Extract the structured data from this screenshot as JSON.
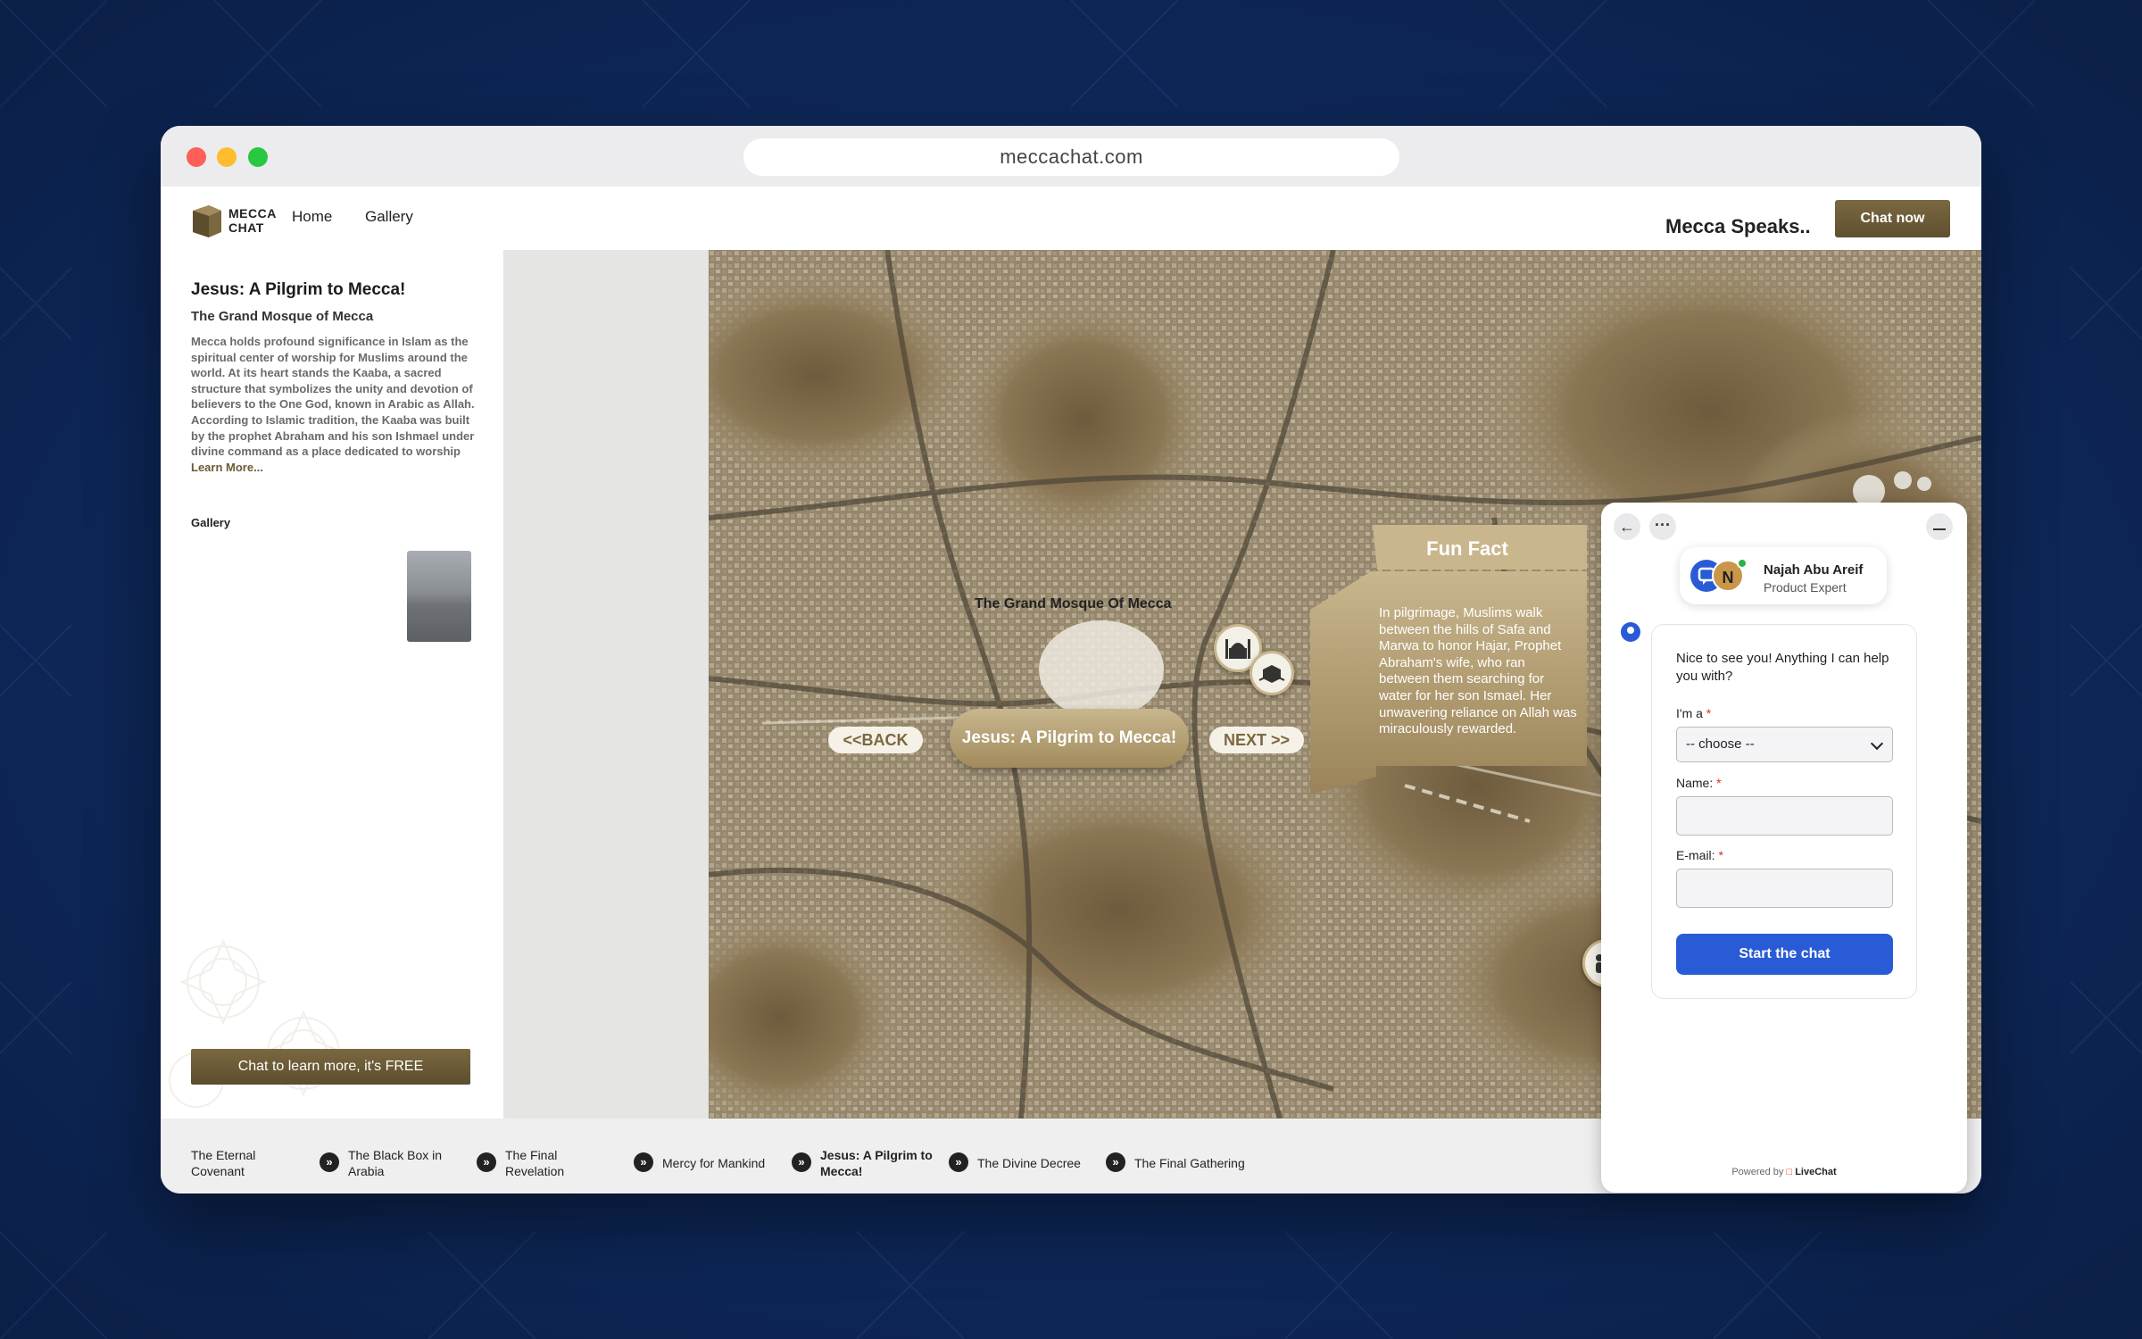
{
  "browser": {
    "url": "meccachat.com"
  },
  "nav": {
    "logo_line1": "MECCA",
    "logo_line2": "CHAT",
    "home": "Home",
    "gallery": "Gallery",
    "tagline": "Mecca Speaks..",
    "chat_now": "Chat now"
  },
  "sidebar": {
    "title": "Jesus: A Pilgrim to Mecca!",
    "subtitle": "The Grand Mosque of Mecca",
    "body": "Mecca holds profound significance in Islam as the spiritual center of worship for Muslims around the world. At its heart stands the Kaaba, a sacred structure that symbolizes the unity and devotion of believers to the One God, known in Arabic as Allah. According to Islamic tradition, the Kaaba was built by the prophet Abraham and his son Ishmael under divine command as a place dedicated to worship",
    "learn_more": "Learn More...",
    "gallery_label": "Gallery",
    "cta": "Chat to learn more, it's FREE"
  },
  "map": {
    "place_label": "The Grand Mosque Of Mecca",
    "back": "<<BACK",
    "next": "NEXT >>",
    "current": "Jesus: A Pilgrim to Mecca!",
    "fun_fact_title": "Fun Fact",
    "fun_fact_text": "In pilgrimage, Muslims walk between the hills of Safa and Marwa to honor Hajar, Prophet Abraham's wife, who ran between them searching for water for her son Ismael. Her unwavering reliance on Allah was miraculously rewarded."
  },
  "bottom_nav": [
    {
      "label": "The Eternal Covenant"
    },
    {
      "label": "The Black Box in Arabia"
    },
    {
      "label": "The Final Revelation"
    },
    {
      "label": "Mercy for Mankind"
    },
    {
      "label": "Jesus: A Pilgrim to Mecca!"
    },
    {
      "label": "The Divine Decree"
    },
    {
      "label": "The Final Gathering"
    }
  ],
  "chat": {
    "agent_initial": "N",
    "agent_name": "Najah Abu Areif",
    "agent_role": "Product Expert",
    "greeting": "Nice to see you! Anything I can help you with?",
    "field_role_label": "I'm a",
    "field_role_value": "-- choose --",
    "field_name_label": "Name:",
    "field_email_label": "E-mail:",
    "required_mark": "*",
    "start_button": "Start the chat",
    "powered_by": "Powered by",
    "brand": "LiveChat"
  },
  "colors": {
    "accent_gold": "#7a6840",
    "chat_blue": "#2a5bd7",
    "background": "#0f2a5e"
  }
}
